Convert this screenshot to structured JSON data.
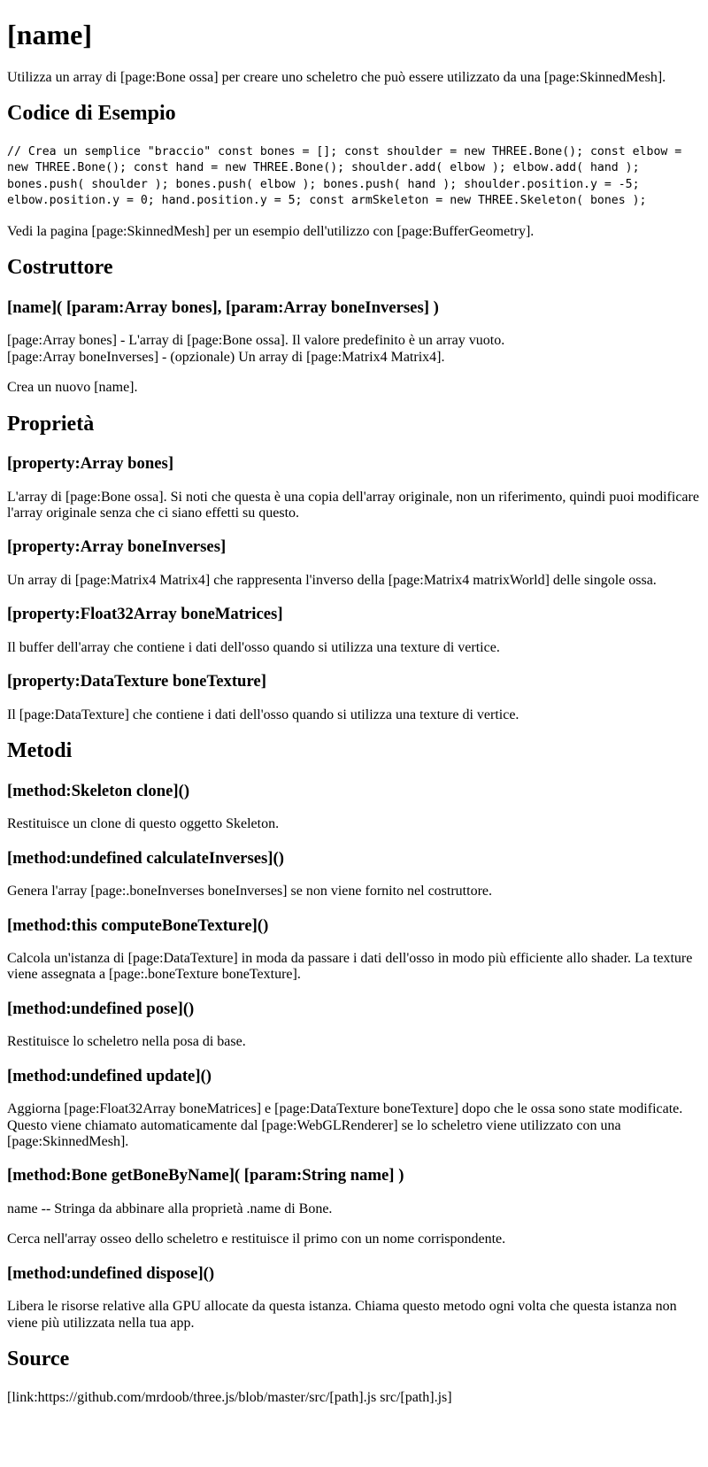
{
  "title": "[name]",
  "intro": "Utilizza un array di [page:Bone ossa] per creare uno scheletro che può essere utilizzato da una [page:SkinnedMesh].",
  "example": {
    "heading": "Codice di Esempio",
    "code": "// Crea un semplice \"braccio\" const bones = []; const shoulder = new THREE.Bone(); const elbow = new THREE.Bone(); const hand = new THREE.Bone(); shoulder.add( elbow ); elbow.add( hand ); bones.push( shoulder ); bones.push( elbow ); bones.push( hand ); shoulder.position.y = -5; elbow.position.y = 0; hand.position.y = 5; const armSkeleton = new THREE.Skeleton( bones );",
    "note": "Vedi la pagina [page:SkinnedMesh] per un esempio dell'utilizzo con [page:BufferGeometry]."
  },
  "constructor": {
    "heading": "Costruttore",
    "signature": "[name]( [param:Array bones], [param:Array boneInverses] )",
    "param_bones": "[page:Array bones] - L'array di [page:Bone ossa]. Il valore predefinito è un array vuoto.",
    "param_inverses": "[page:Array boneInverses] - (opzionale) Un array di [page:Matrix4 Matrix4].",
    "description": "Crea un nuovo [name]."
  },
  "properties": {
    "heading": "Proprietà",
    "items": [
      {
        "title": "[property:Array bones]",
        "text": "L'array di [page:Bone ossa]. Si noti che questa è una copia dell'array originale, non un riferimento, quindi puoi modificare l'array originale senza che ci siano effetti su questo."
      },
      {
        "title": "[property:Array boneInverses]",
        "text": "Un array di [page:Matrix4 Matrix4] che rappresenta l'inverso della [page:Matrix4 matrixWorld] delle singole ossa."
      },
      {
        "title": "[property:Float32Array boneMatrices]",
        "text": "Il buffer dell'array che contiene i dati dell'osso quando si utilizza una texture di vertice."
      },
      {
        "title": "[property:DataTexture boneTexture]",
        "text": "Il [page:DataTexture] che contiene i dati dell'osso quando si utilizza una texture di vertice."
      }
    ]
  },
  "methods": {
    "heading": "Metodi",
    "items": [
      {
        "title": "[method:Skeleton clone]()",
        "text": "Restituisce un clone di questo oggetto Skeleton."
      },
      {
        "title": "[method:undefined calculateInverses]()",
        "text": "Genera l'array [page:.boneInverses boneInverses] se non viene fornito nel costruttore."
      },
      {
        "title": "[method:this computeBoneTexture]()",
        "text": "Calcola un'istanza di [page:DataTexture] in moda da passare i dati dell'osso in modo più efficiente allo shader. La texture viene assegnata a [page:.boneTexture boneTexture]."
      },
      {
        "title": "[method:undefined pose]()",
        "text": "Restituisce lo scheletro nella posa di base."
      },
      {
        "title": "[method:undefined update]()",
        "text": "Aggiorna [page:Float32Array boneMatrices] e [page:DataTexture boneTexture] dopo che le ossa sono state modificate. Questo viene chiamato automaticamente dal [page:WebGLRenderer] se lo scheletro viene utilizzato con una [page:SkinnedMesh]."
      },
      {
        "title": "[method:Bone getBoneByName]( [param:String name] )",
        "param": "name -- Stringa da abbinare alla proprietà .name di Bone.",
        "text": "Cerca nell'array osseo dello scheletro e restituisce il primo con un nome corrispondente."
      },
      {
        "title": "[method:undefined dispose]()",
        "text": "Libera le risorse relative alla GPU allocate da questa istanza. Chiama questo metodo ogni volta che questa istanza non viene più utilizzata nella tua app."
      }
    ]
  },
  "source": {
    "heading": "Source",
    "link": "[link:https://github.com/mrdoob/three.js/blob/master/src/[path].js src/[path].js]"
  }
}
